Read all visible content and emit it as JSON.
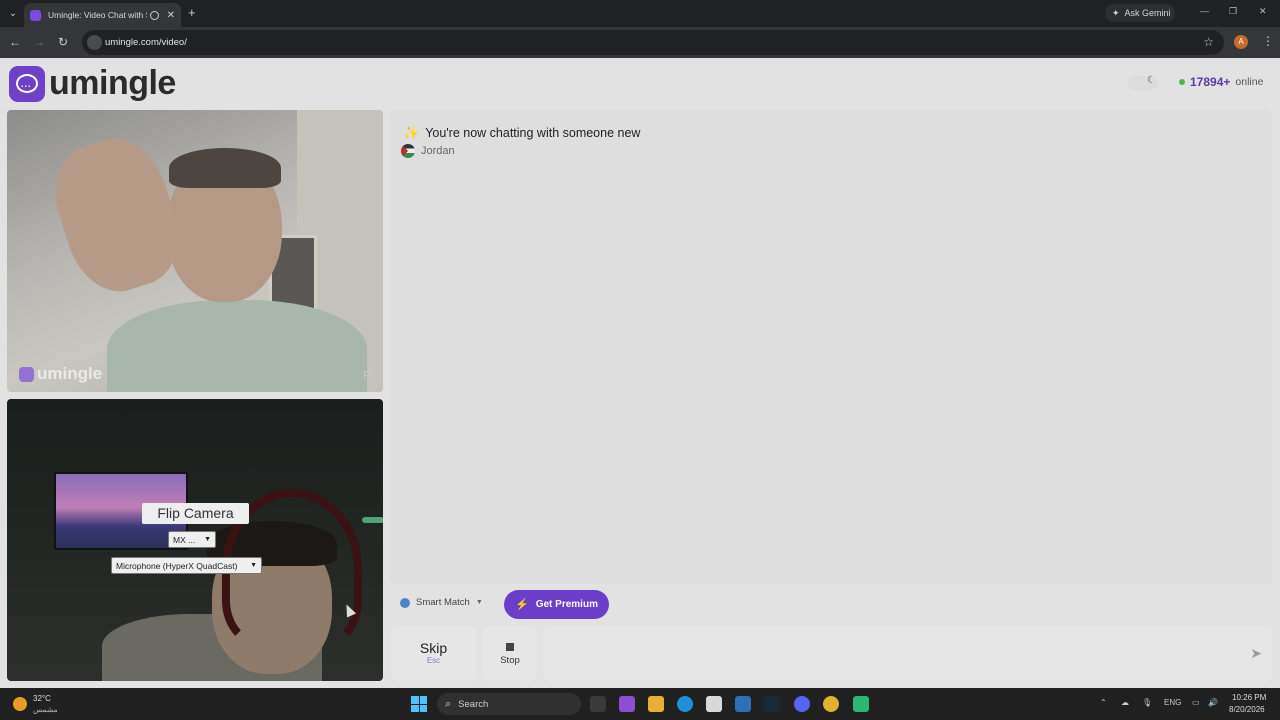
{
  "browser": {
    "tab_title": "Umingle: Video Chat with S",
    "ask_gemini": "Ask Gemini",
    "url": "umingle.com/video/",
    "profile_initial": "A"
  },
  "header": {
    "logo_text": "umingle",
    "online_count": "17894+",
    "online_label": "online"
  },
  "remote_video": {
    "watermark": "umingle"
  },
  "local_video": {
    "flip_camera": "Flip Camera",
    "camera_select": "MX ...",
    "microphone_select": "Microphone (HyperX QuadCast)"
  },
  "chat": {
    "status_message": "You're now chatting with someone new",
    "partner_name": "Jordan"
  },
  "controls": {
    "smart_match": "Smart Match",
    "get_premium": "Get Premium",
    "skip_label": "Skip",
    "skip_key": "Esc",
    "stop_label": "Stop"
  },
  "taskbar": {
    "weather_temp": "32°C",
    "weather_desc": "مشمس",
    "search_placeholder": "Search",
    "language": "ENG",
    "time": "10:26 PM",
    "date": "8/20/2026"
  },
  "colors": {
    "brand": "#6b3ec9",
    "online_dot": "#49b85a"
  }
}
